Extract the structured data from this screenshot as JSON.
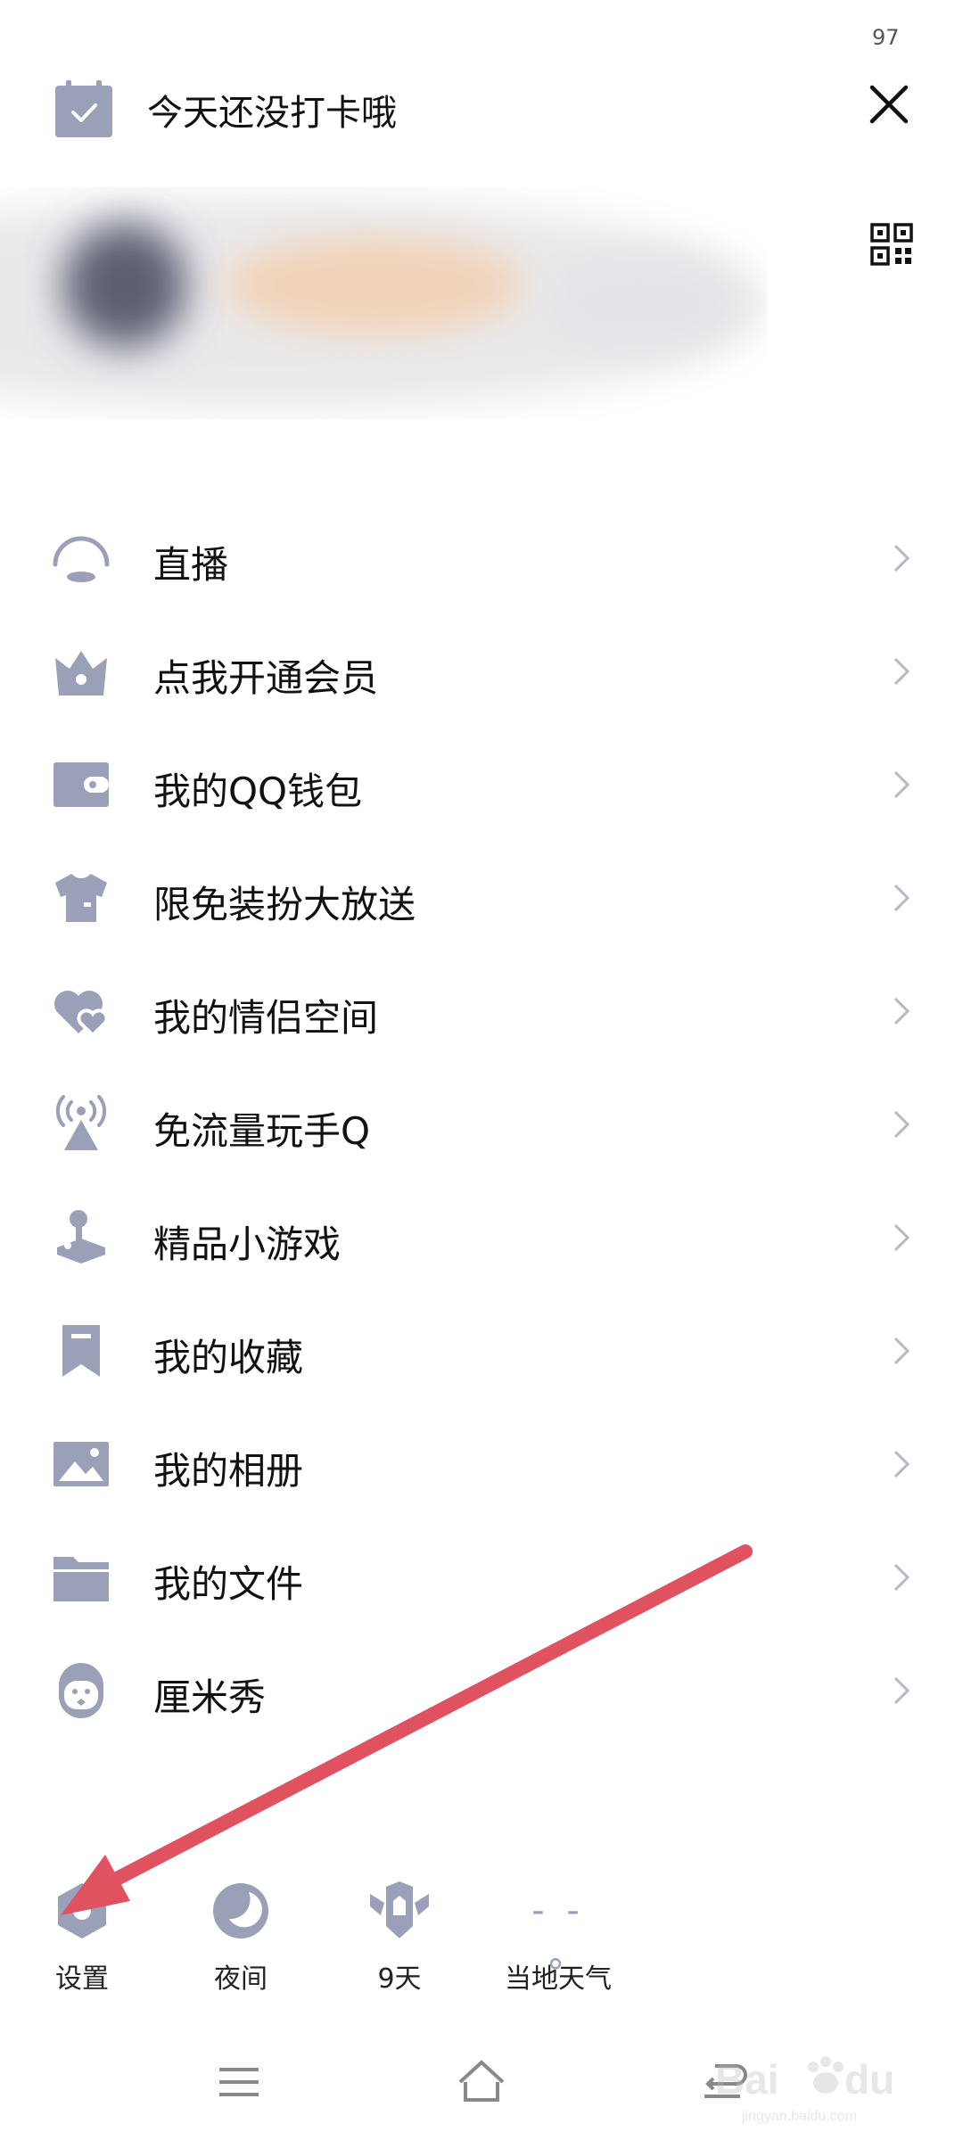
{
  "status": {
    "battery": "97"
  },
  "header": {
    "checkin_text": "今天还没打卡哦"
  },
  "menu": [
    {
      "label": "直播",
      "icon": "live-icon"
    },
    {
      "label": "点我开通会员",
      "icon": "crown-icon"
    },
    {
      "label": "我的QQ钱包",
      "icon": "wallet-icon"
    },
    {
      "label": "限免装扮大放送",
      "icon": "tshirt-icon"
    },
    {
      "label": "我的情侣空间",
      "icon": "hearts-icon"
    },
    {
      "label": "免流量玩手Q",
      "icon": "signal-tower-icon"
    },
    {
      "label": "精品小游戏",
      "icon": "joystick-icon"
    },
    {
      "label": "我的收藏",
      "icon": "bookmark-icon"
    },
    {
      "label": "我的相册",
      "icon": "photo-icon"
    },
    {
      "label": "我的文件",
      "icon": "folder-icon"
    },
    {
      "label": "厘米秀",
      "icon": "avatar-face-icon"
    }
  ],
  "quick_actions": [
    {
      "label": "设置",
      "icon": "settings-icon"
    },
    {
      "label": "夜间",
      "icon": "moon-icon"
    },
    {
      "label": "9天",
      "icon": "badge-wings-icon"
    },
    {
      "label": "当地天气",
      "icon": "weather-icon"
    }
  ],
  "weather_placeholder": "- -°",
  "colors": {
    "icon": "#9aa0b8",
    "annotation_arrow": "#e05260",
    "text": "#111111"
  }
}
